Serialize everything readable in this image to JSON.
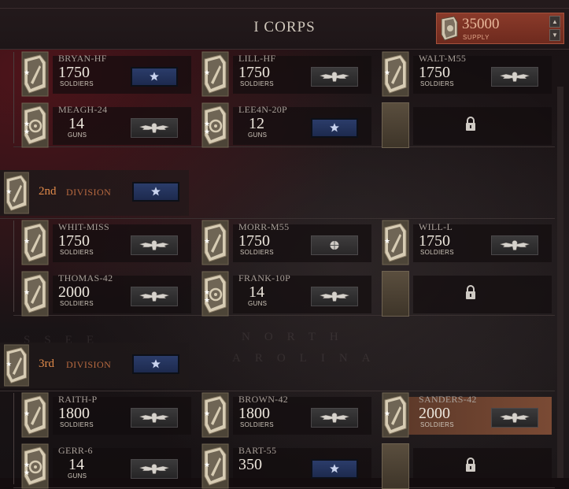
{
  "header": {
    "title": "I CORPS",
    "supply_value": "35000",
    "supply_label": "SUPPLY"
  },
  "map_text": [
    "NORTH",
    "AROLINA",
    "SSEE"
  ],
  "divisions": [
    {
      "number": null,
      "word": null,
      "units": [
        {
          "name": "BRYAN-HF",
          "count": "1750",
          "label": "SOLDIERS",
          "type": "inf",
          "badge": "star"
        },
        {
          "name": "LILL-HF",
          "count": "1750",
          "label": "SOLDIERS",
          "type": "inf",
          "badge": "eagle"
        },
        {
          "name": "WALT-M55",
          "count": "1750",
          "label": "SOLDIERS",
          "type": "inf",
          "badge": "eagle"
        },
        {
          "name": "MEAGH-24",
          "count": "14",
          "label": "GUNS",
          "type": "art",
          "badge": "eagle"
        },
        {
          "name": "LEE4N-20P",
          "count": "12",
          "label": "GUNS",
          "type": "art",
          "badge": "star"
        },
        {
          "name": "",
          "count": "",
          "label": "",
          "type": "locked",
          "badge": "none"
        }
      ]
    },
    {
      "number": "2nd",
      "word": "DIVISION",
      "units": [
        {
          "name": "WHIT-MISS",
          "count": "1750",
          "label": "SOLDIERS",
          "type": "inf",
          "badge": "eagle"
        },
        {
          "name": "MORR-M55",
          "count": "1750",
          "label": "SOLDIERS",
          "type": "inf",
          "badge": "leaf"
        },
        {
          "name": "WILL-L",
          "count": "1750",
          "label": "SOLDIERS",
          "type": "inf",
          "badge": "eagle"
        },
        {
          "name": "THOMAS-42",
          "count": "2000",
          "label": "SOLDIERS",
          "type": "inf",
          "badge": "eagle"
        },
        {
          "name": "FRANK-10P",
          "count": "14",
          "label": "GUNS",
          "type": "art",
          "badge": "eagle"
        },
        {
          "name": "",
          "count": "",
          "label": "",
          "type": "locked",
          "badge": "none"
        }
      ]
    },
    {
      "number": "3rd",
      "word": "DIVISION",
      "units": [
        {
          "name": "RAITH-P",
          "count": "1800",
          "label": "SOLDIERS",
          "type": "inf",
          "badge": "eagle"
        },
        {
          "name": "BROWN-42",
          "count": "1800",
          "label": "SOLDIERS",
          "type": "inf",
          "badge": "eagle"
        },
        {
          "name": "SANDERS-42",
          "count": "2000",
          "label": "SOLDIERS",
          "type": "inf",
          "badge": "eagle",
          "selected": true
        },
        {
          "name": "GERR-6",
          "count": "14",
          "label": "GUNS",
          "type": "art",
          "badge": "eagle"
        },
        {
          "name": "BART-55",
          "count": "350",
          "label": "",
          "type": "inf",
          "badge": "star"
        },
        {
          "name": "",
          "count": "",
          "label": "",
          "type": "locked",
          "badge": "none"
        }
      ]
    }
  ],
  "colors": {
    "accent_orange": "#e08a4a",
    "supply_bg": "#7a3424",
    "badge_blue": "#24345c",
    "selected_bg": "#6c4230"
  }
}
